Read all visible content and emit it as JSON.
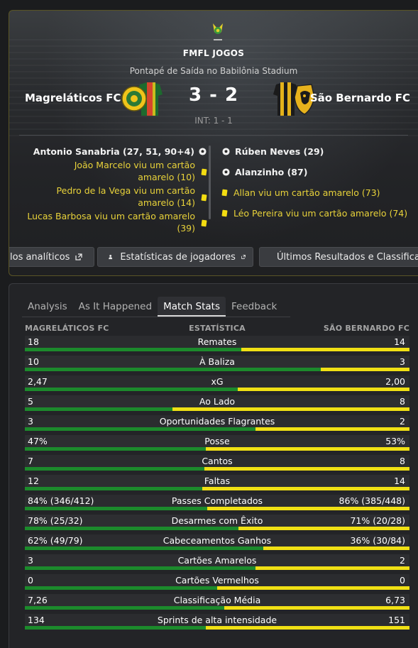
{
  "header": {
    "competition": "FMFL JOGOS",
    "kickoff": "Pontapé de Saída no Babilônia Stadium",
    "home_team": "Magreláticos FC",
    "away_team": "São Bernardo FC",
    "score": "3 - 2",
    "int_score": "INT: 1 - 1"
  },
  "events": {
    "home": [
      {
        "type": "goal",
        "text": "Antonio Sanabria (27, 51, 90+4)"
      },
      {
        "type": "card",
        "text": "João Marcelo viu um cartão amarelo (10)"
      },
      {
        "type": "card",
        "text": "Pedro de la Vega viu um cartão amarelo (14)"
      },
      {
        "type": "card",
        "text": "Lucas Barbosa viu um cartão amarelo (39)"
      }
    ],
    "away": [
      {
        "type": "goal",
        "text": "Rúben Neves (29)"
      },
      {
        "type": "goal",
        "text": "Alanzinho (87)"
      },
      {
        "type": "card",
        "text": "Allan viu um cartão amarelo (73)"
      },
      {
        "type": "card",
        "text": "Léo Pereira viu um cartão amarelo (74)"
      }
    ]
  },
  "chips": {
    "analytics": "los analíticos",
    "player_stats": "Estatísticas de jogadores",
    "results": "Últimos Resultados e Classificação"
  },
  "tabs": [
    "Analysis",
    "As It Happened",
    "Match Stats",
    "Feedback"
  ],
  "active_tab": "Match Stats",
  "stats_header": {
    "home": "MAGRELÁTICOS FC",
    "label": "ESTATÍSTICA",
    "away": "SÃO BERNARDO FC"
  },
  "colors": {
    "home_bar": "#1c8a2c",
    "away_bar": "#f0e014",
    "card_border": "#5a5526"
  },
  "stats": [
    {
      "label": "Remates",
      "home": "18",
      "away": "14",
      "home_share": 0.5625
    },
    {
      "label": "À Baliza",
      "home": "10",
      "away": "3",
      "home_share": 0.7692
    },
    {
      "label": "xG",
      "home": "2,47",
      "away": "2,00",
      "home_share": 0.5526
    },
    {
      "label": "Ao Lado",
      "home": "5",
      "away": "8",
      "home_share": 0.3846
    },
    {
      "label": "Oportunidades Flagrantes",
      "home": "3",
      "away": "2",
      "home_share": 0.6
    },
    {
      "label": "Posse",
      "home": "47%",
      "away": "53%",
      "home_share": 0.47
    },
    {
      "label": "Cantos",
      "home": "7",
      "away": "8",
      "home_share": 0.4667
    },
    {
      "label": "Faltas",
      "home": "12",
      "away": "14",
      "home_share": 0.4615
    },
    {
      "label": "Passes Completados",
      "home": "84% (346/412)",
      "away": "86% (385/448)",
      "home_share": 0.4733
    },
    {
      "label": "Desarmes com Êxito",
      "home": "78% (25/32)",
      "away": "71% (20/28)",
      "home_share": 0.5556
    },
    {
      "label": "Cabeceamentos Ganhos",
      "home": "62% (49/79)",
      "away": "36% (30/84)",
      "home_share": 0.6203
    },
    {
      "label": "Cartões Amarelos",
      "home": "3",
      "away": "2",
      "home_share": 0.6
    },
    {
      "label": "Cartões Vermelhos",
      "home": "0",
      "away": "0",
      "home_share": 0.5
    },
    {
      "label": "Classificação Média",
      "home": "7,26",
      "away": "6,73",
      "home_share": 0.5189
    },
    {
      "label": "Sprints de alta intensidade",
      "home": "134",
      "away": "151",
      "home_share": 0.4702
    }
  ]
}
